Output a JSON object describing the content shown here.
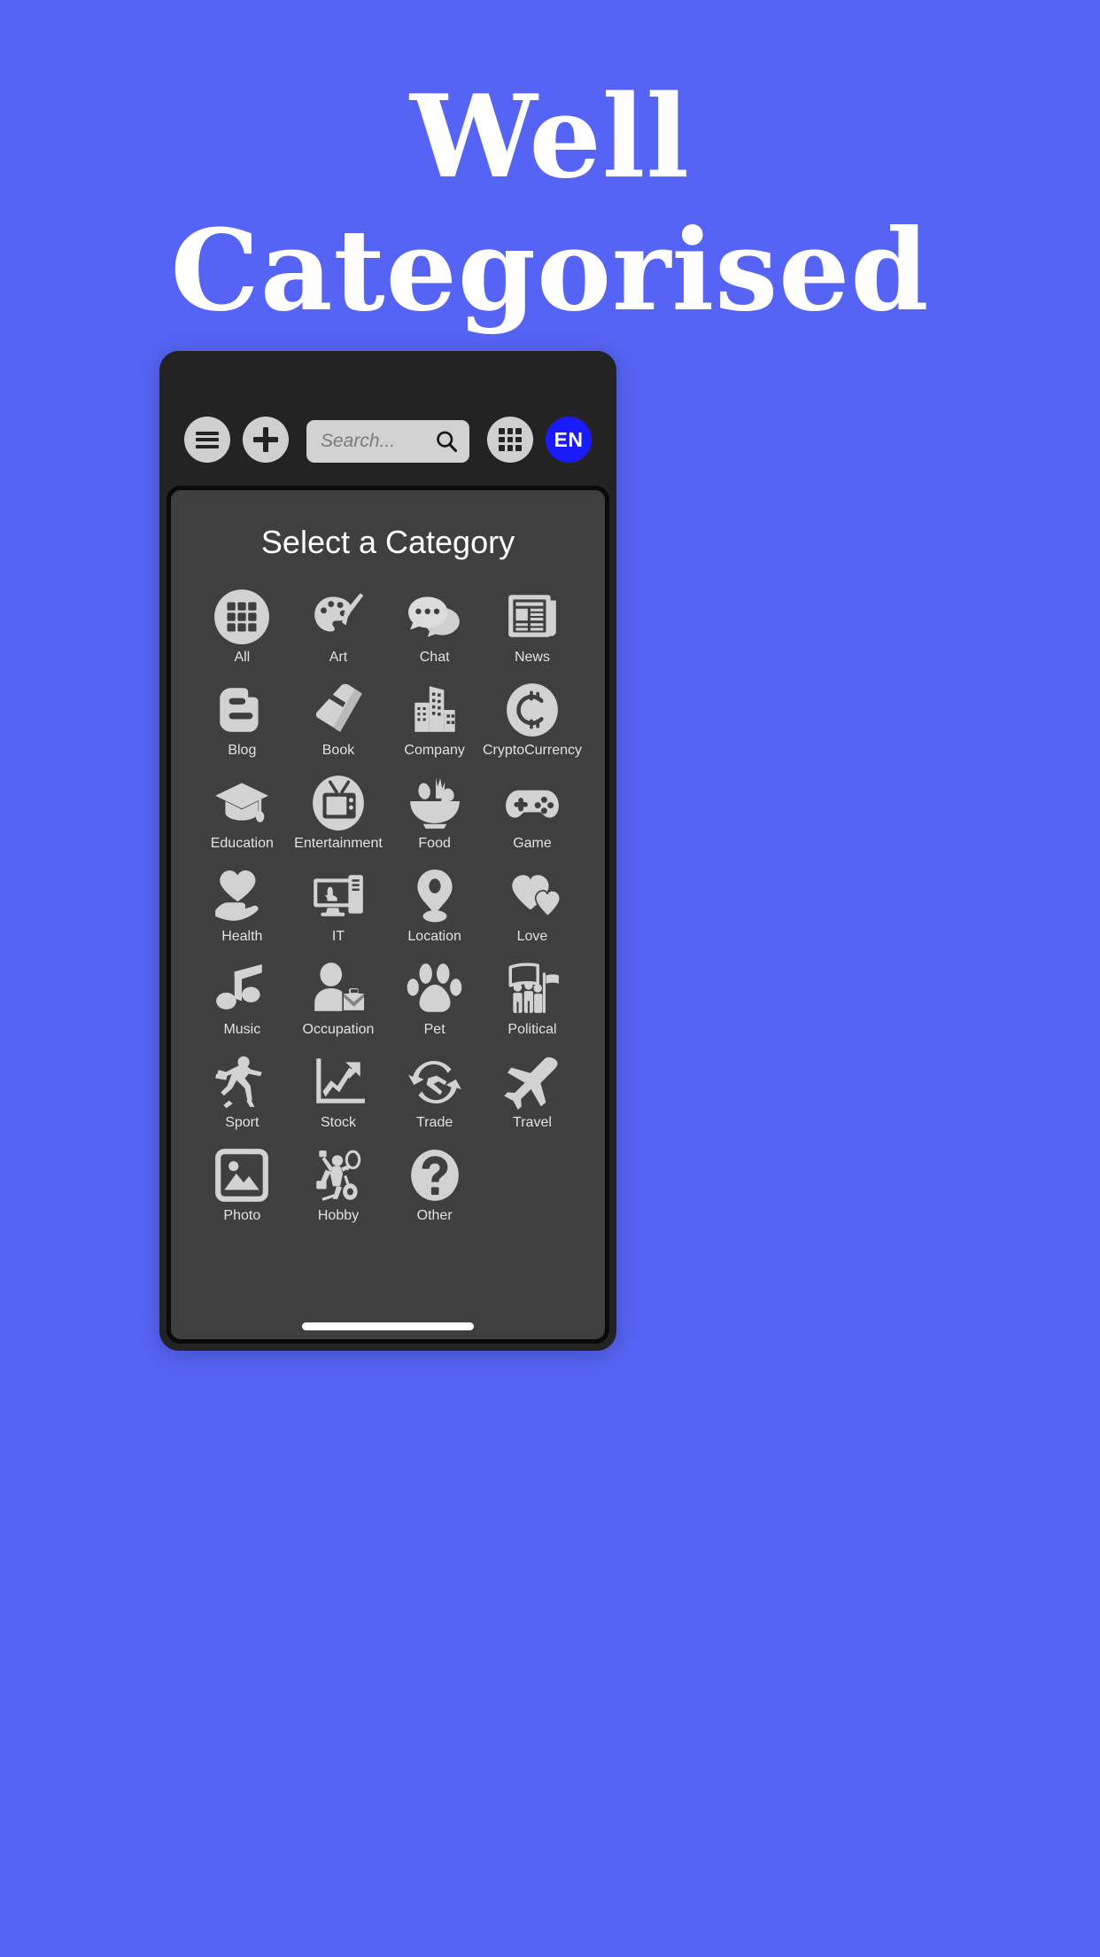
{
  "theme": {
    "background": "#5664f5",
    "phone_frame": "#232323",
    "panel": "#3f3f3f",
    "icon_fill": "#d2d2d2",
    "accent_lang": "#1a1aff"
  },
  "hero": {
    "line1": "Well",
    "line2": "Categorised"
  },
  "toolbar": {
    "menu_icon": "hamburger-menu-icon",
    "add_icon": "plus-icon",
    "search": {
      "placeholder": "Search...",
      "value": "",
      "icon": "magnifier-icon"
    },
    "grid_icon": "grid-view-icon",
    "language_label": "EN"
  },
  "panel": {
    "title": "Select a Category",
    "categories": [
      {
        "label": "All",
        "icon": "grid-circle-icon"
      },
      {
        "label": "Art",
        "icon": "palette-brush-icon"
      },
      {
        "label": "Chat",
        "icon": "speech-bubbles-icon"
      },
      {
        "label": "News",
        "icon": "newspaper-icon"
      },
      {
        "label": "Blog",
        "icon": "blogger-b-icon"
      },
      {
        "label": "Book",
        "icon": "book-icon"
      },
      {
        "label": "Company",
        "icon": "buildings-icon"
      },
      {
        "label": "CryptoCurrency",
        "icon": "bitcoin-coin-icon"
      },
      {
        "label": "Education",
        "icon": "graduation-cap-icon"
      },
      {
        "label": "Entertainment",
        "icon": "television-icon"
      },
      {
        "label": "Food",
        "icon": "salad-bowl-icon"
      },
      {
        "label": "Game",
        "icon": "gamepad-icon"
      },
      {
        "label": "Health",
        "icon": "heart-in-hand-icon"
      },
      {
        "label": "IT",
        "icon": "desktop-computer-icon"
      },
      {
        "label": "Location",
        "icon": "map-pin-icon"
      },
      {
        "label": "Love",
        "icon": "two-hearts-icon"
      },
      {
        "label": "Music",
        "icon": "music-note-icon"
      },
      {
        "label": "Occupation",
        "icon": "worker-briefcase-icon"
      },
      {
        "label": "Pet",
        "icon": "paw-print-icon"
      },
      {
        "label": "Political",
        "icon": "protest-crowd-icon"
      },
      {
        "label": "Sport",
        "icon": "running-person-icon"
      },
      {
        "label": "Stock",
        "icon": "growth-chart-icon"
      },
      {
        "label": "Trade",
        "icon": "handshake-cycle-icon"
      },
      {
        "label": "Travel",
        "icon": "airplane-icon"
      },
      {
        "label": "Photo",
        "icon": "image-frame-icon"
      },
      {
        "label": "Hobby",
        "icon": "hobby-person-icon"
      },
      {
        "label": "Other",
        "icon": "question-mark-icon"
      }
    ]
  }
}
